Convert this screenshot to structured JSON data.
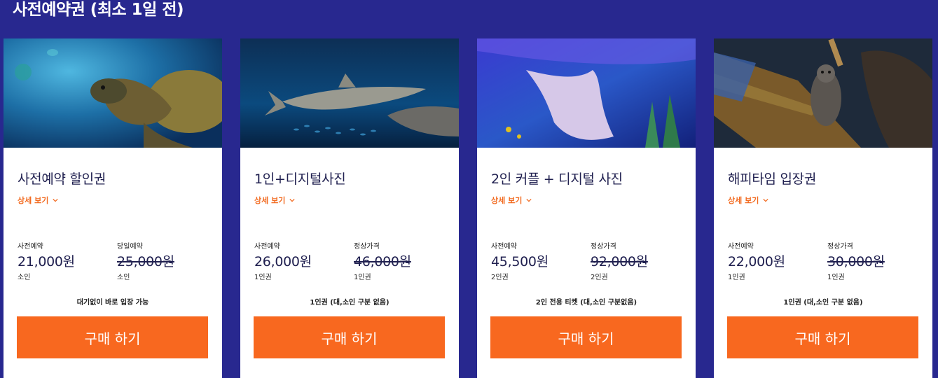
{
  "section": {
    "title": "사전예약권 (최소 1일 전)"
  },
  "details_label": "상세 보기",
  "cards": [
    {
      "title": "사전예약 할인권",
      "photo": "sea-turtle-photo",
      "left": {
        "label": "사전예약",
        "value": "21,000원",
        "unit": "소인"
      },
      "right": {
        "label": "당일예약",
        "value": "25,000원",
        "unit": "소인"
      },
      "note": "대기없이 바로 입장 가능",
      "button": "구매 하기"
    },
    {
      "title": "1인+디지털사진",
      "photo": "shark-photo",
      "left": {
        "label": "사전예약",
        "value": "26,000원",
        "unit": "1인권"
      },
      "right": {
        "label": "정상가격",
        "value": "46,000원",
        "unit": "1인권"
      },
      "note": "1인권 (대,소인 구분 없음)",
      "button": "구매 하기"
    },
    {
      "title": "2인 커플 + 디지털 사진",
      "photo": "stingray-photo",
      "left": {
        "label": "사전예약",
        "value": "45,500원",
        "unit": "2인권"
      },
      "right": {
        "label": "정상가격",
        "value": "92,000원",
        "unit": "2인권"
      },
      "note": "2인 전용 티켓 (대,소인 구분없음)",
      "button": "구매 하기"
    },
    {
      "title": "해피타임 입장권",
      "photo": "otter-photo",
      "left": {
        "label": "사전예약",
        "value": "22,000원",
        "unit": "1인권"
      },
      "right": {
        "label": "정상가격",
        "value": "30,000원",
        "unit": "1인권"
      },
      "note": "1인권 (대,소인 구분 없음)",
      "button": "구매 하기"
    }
  ],
  "colors": {
    "background": "#28288f",
    "accent": "#f8681f",
    "title_text": "#1f1f4f"
  },
  "icons": {
    "details": "chevron-down-icon"
  }
}
